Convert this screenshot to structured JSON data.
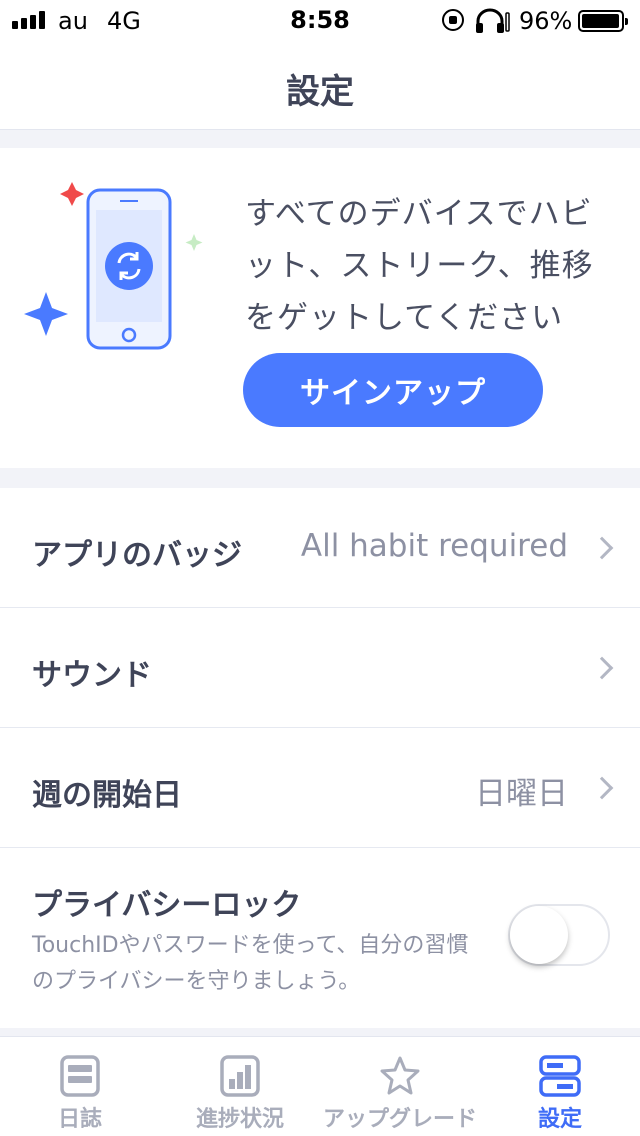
{
  "status_bar": {
    "carrier": "au",
    "network": "4G",
    "time": "8:58",
    "battery_percent": "96%",
    "icons": [
      "signal-icon",
      "rotation-lock-icon",
      "headphones-icon",
      "battery-icon"
    ]
  },
  "nav": {
    "title": "設定"
  },
  "signup": {
    "message_lines": [
      "すべてのデバイスでハビ",
      "ット、ストリーク、推移",
      "をゲットしてください"
    ],
    "button_label": "サインアップ",
    "illustration_icon": "phone-sync-icon"
  },
  "settings": {
    "app_badge": {
      "label": "アプリのバッジ",
      "value": "All habit required"
    },
    "sound": {
      "label": "サウンド"
    },
    "week_start": {
      "label": "週の開始日",
      "value": "日曜日"
    },
    "privacy_lock": {
      "label": "プライバシーロック",
      "description_lines": [
        "TouchIDやパスワードを使って、自分の習慣",
        "のプライバシーを守りましょう。"
      ],
      "enabled": false
    }
  },
  "tabs": [
    {
      "label": "日誌",
      "icon": "journal-icon",
      "active": false
    },
    {
      "label": "進捗状況",
      "icon": "progress-chart-icon",
      "active": false
    },
    {
      "label": "アップグレード",
      "icon": "star-icon",
      "active": false
    },
    {
      "label": "設定",
      "icon": "settings-icon",
      "active": true
    }
  ],
  "colors": {
    "accent": "#4a7aff",
    "active_tab": "#3f6cf7",
    "inactive_tab": "#a9adbb",
    "text_primary": "#3f4458",
    "text_secondary": "#8d91a3",
    "background": "#f2f3f8"
  }
}
